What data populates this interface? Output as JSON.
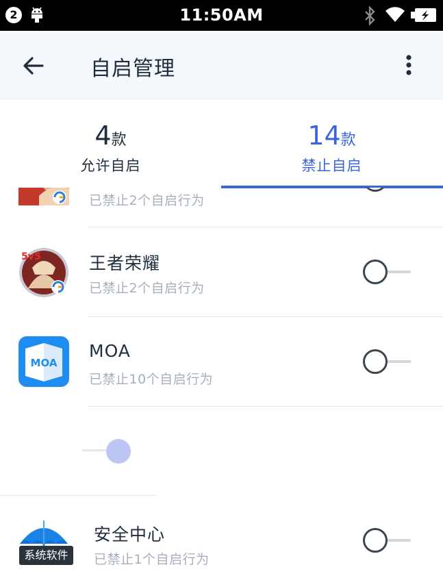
{
  "status_bar": {
    "notification_count": "2",
    "time": "11:50AM",
    "icons": [
      "android-debug-icon",
      "bluetooth-icon",
      "wifi-icon",
      "battery-charging-icon"
    ]
  },
  "app_bar": {
    "title": "自启管理",
    "back_icon": "arrow-left-icon",
    "more_icon": "more-vertical-icon"
  },
  "tabs": [
    {
      "count": "4",
      "unit": "款",
      "label": "允许自启",
      "selected": false
    },
    {
      "count": "14",
      "unit": "款",
      "label": "禁止自启",
      "selected": true
    }
  ],
  "apps": [
    {
      "name": "",
      "subtitle": "已禁止2个自启行为",
      "enabled": false
    },
    {
      "name": "王者荣耀",
      "subtitle": "已禁止2个自启行为",
      "enabled": false
    },
    {
      "name": "MOA",
      "subtitle": "已禁止10个自启行为",
      "enabled": false,
      "icon_text": "MOA"
    },
    {
      "name": "安全中心",
      "subtitle": "已禁止1个自启行为",
      "enabled": false,
      "badge": "系统软件"
    }
  ],
  "colors": {
    "accent": "#3a63dd",
    "text_primary": "#1f2d3d",
    "text_secondary": "#a6b0bd",
    "appbar_bg": "#f5f8fc",
    "moa_blue": "#1e8df2",
    "security_blue": "#1a83e8"
  }
}
